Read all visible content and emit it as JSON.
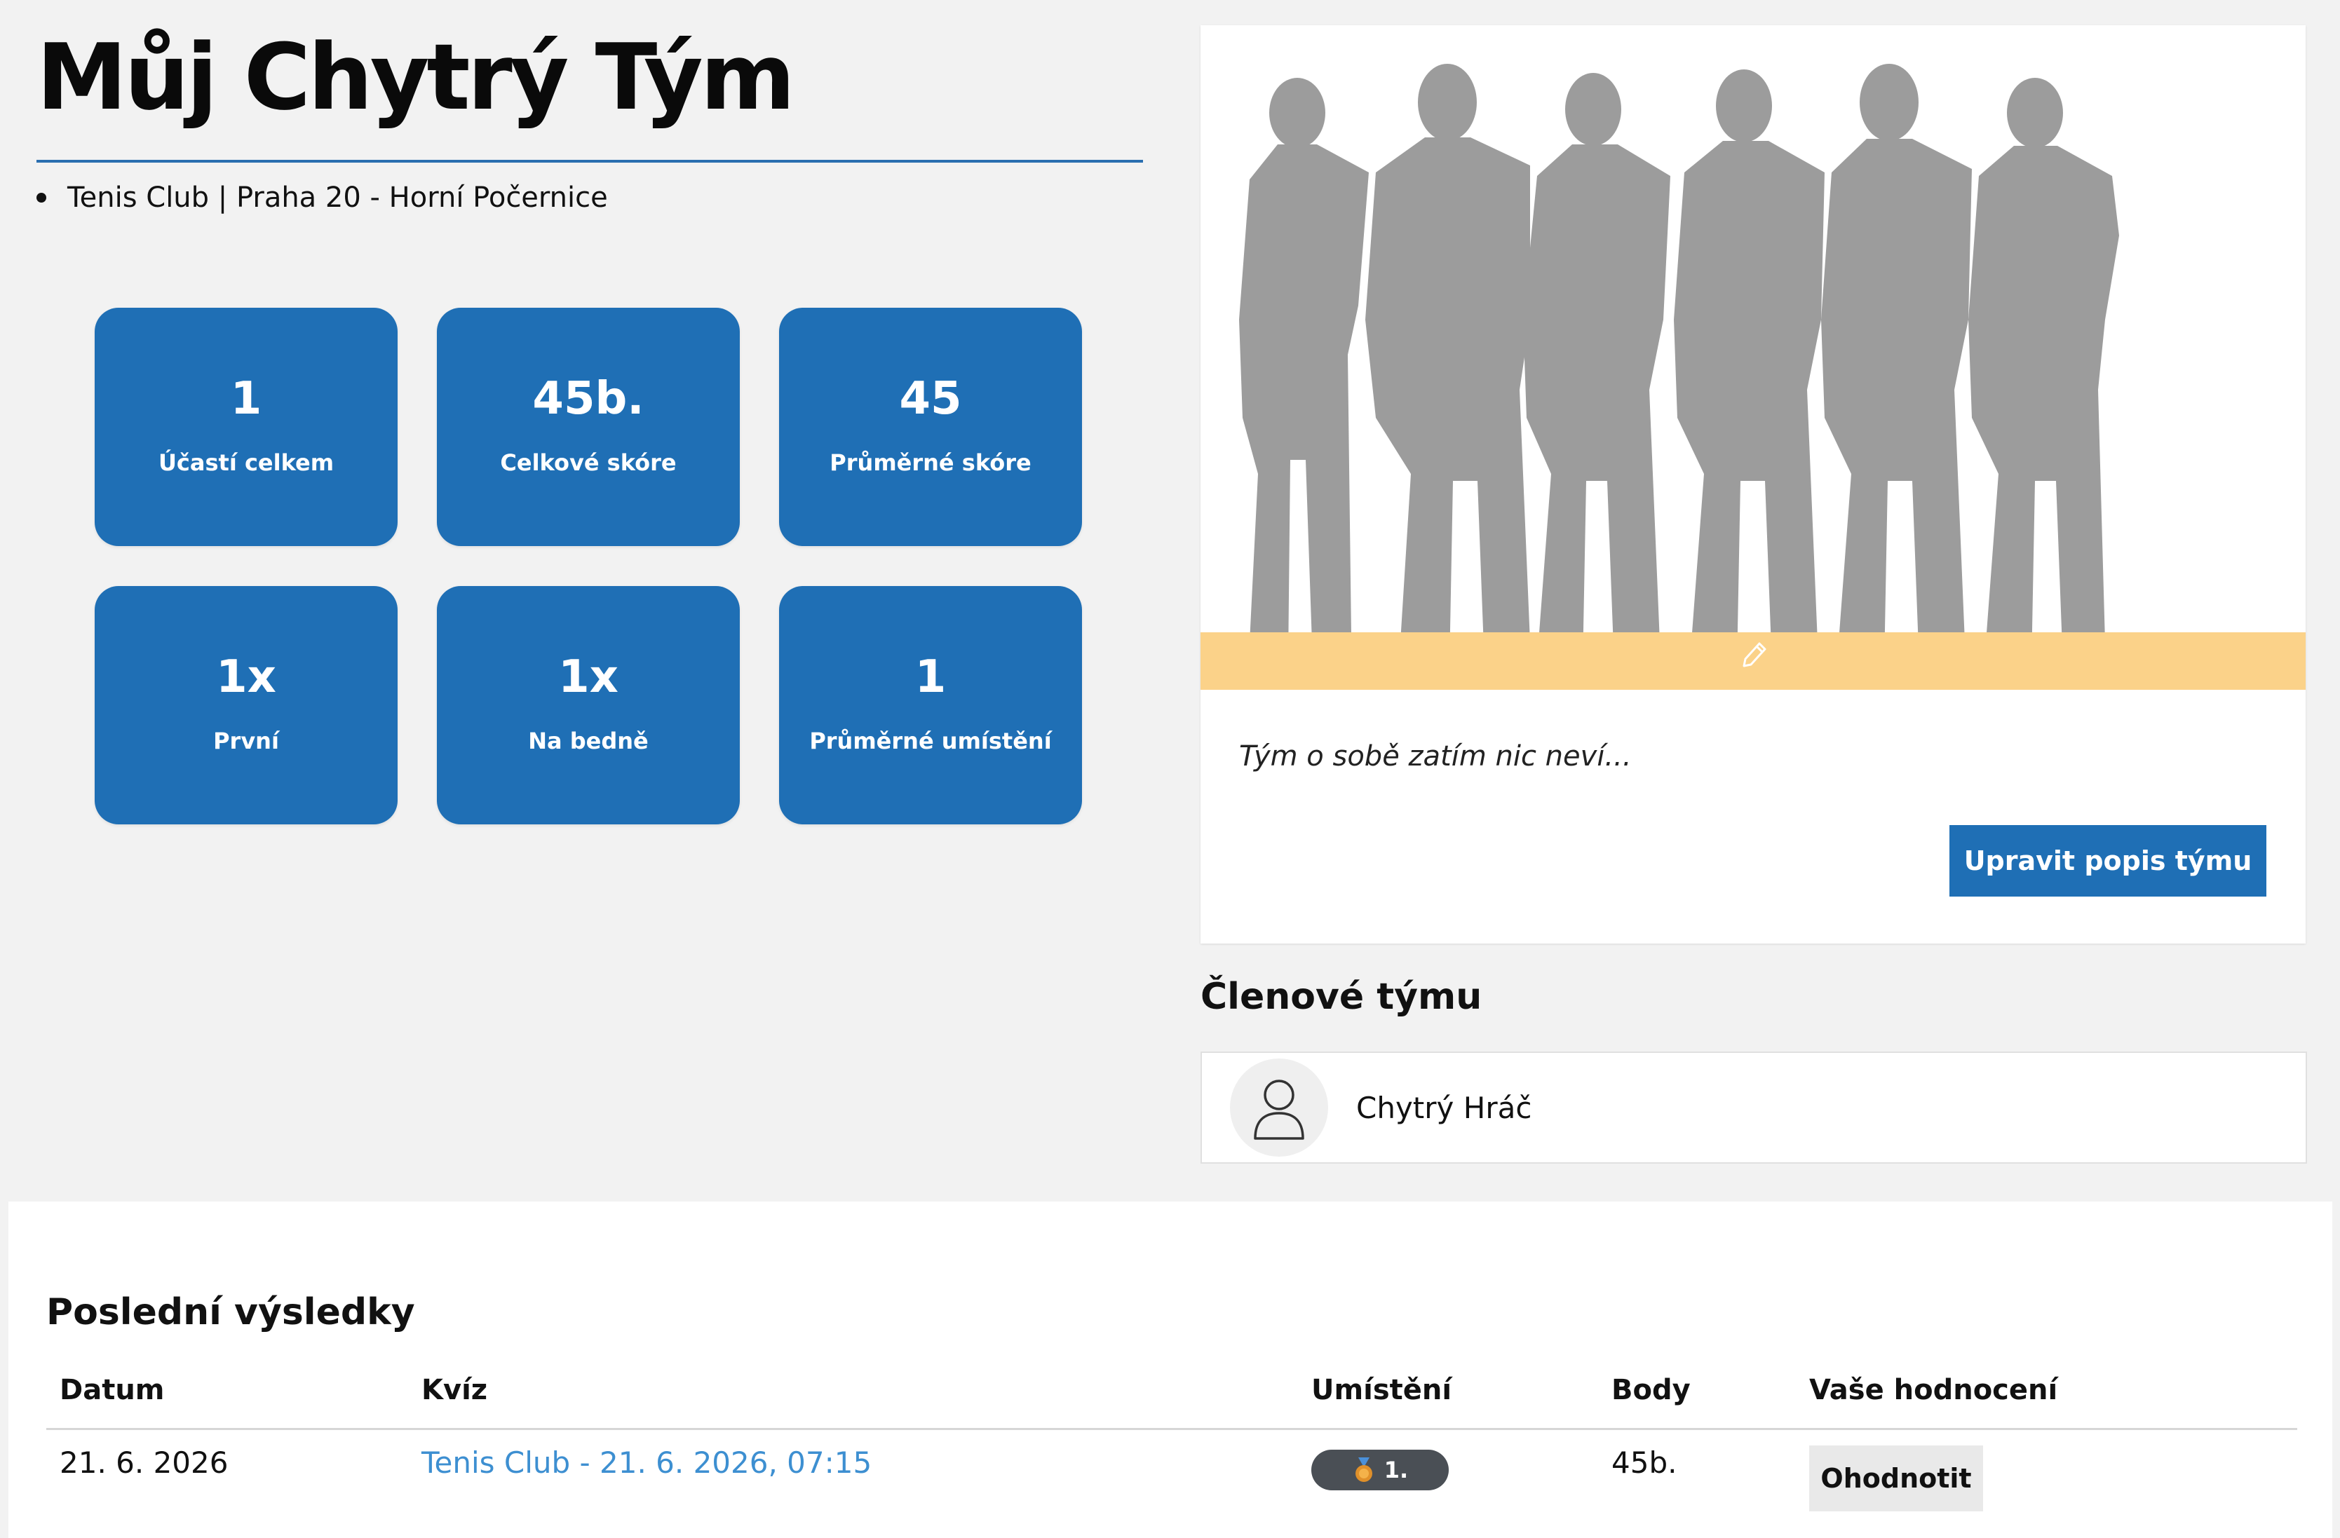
{
  "team": {
    "name": "Můj Chytrý Tým",
    "location": "Tenis Club | Praha 20 - Horní Počernice",
    "description": "Tým o sobě zatím nic neví...",
    "edit_description_label": "Upravit popis týmu"
  },
  "stats": [
    {
      "value": "1",
      "label": "Účastí celkem"
    },
    {
      "value": "45b.",
      "label": "Celkové skóre"
    },
    {
      "value": "45",
      "label": "Průměrné skóre"
    },
    {
      "value": "1x",
      "label": "První"
    },
    {
      "value": "1x",
      "label": "Na bedně"
    },
    {
      "value": "1",
      "label": "Průměrné umístění"
    }
  ],
  "members": {
    "heading": "Členové týmu",
    "list": [
      {
        "name": "Chytrý Hráč"
      }
    ]
  },
  "results": {
    "heading": "Poslední výsledky",
    "columns": [
      "Datum",
      "Kvíz",
      "Umístění",
      "Body",
      "Vaše hodnocení"
    ],
    "rows": [
      {
        "date": "21. 6. 2026",
        "quiz": "Tenis Club - 21. 6. 2026, 07:15",
        "placement": "1.",
        "points": "45b.",
        "rate_label": "Ohodnotit"
      }
    ]
  },
  "colors": {
    "accent": "#1f6fb5",
    "link": "#3d8fd1",
    "photo_band": "#fbd289",
    "background": "#f2f2f2"
  },
  "icons": {
    "team_photo": "team-silhouette-placeholder",
    "edit_photo": "pencil-icon",
    "member_avatar": "user-icon",
    "placement": "medal-icon"
  }
}
